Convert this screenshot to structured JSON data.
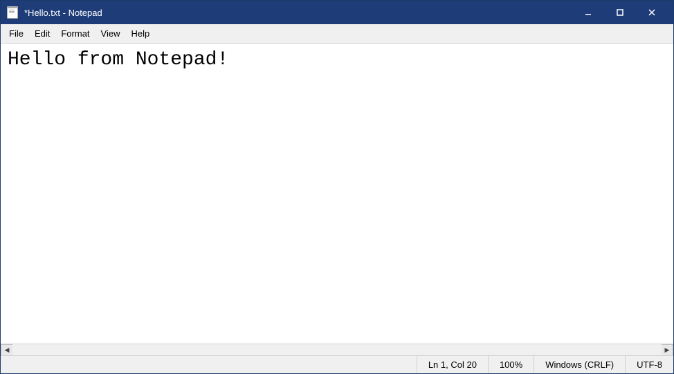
{
  "window": {
    "title": "*Hello.txt - Notepad",
    "icon": "notepad-icon"
  },
  "title_bar": {
    "minimize_label": "minimize",
    "maximize_label": "maximize",
    "close_label": "close"
  },
  "menu_bar": {
    "items": [
      {
        "id": "file",
        "label": "File"
      },
      {
        "id": "edit",
        "label": "Edit"
      },
      {
        "id": "format",
        "label": "Format"
      },
      {
        "id": "view",
        "label": "View"
      },
      {
        "id": "help",
        "label": "Help"
      }
    ]
  },
  "editor": {
    "content": "Hello from Notepad!"
  },
  "status_bar": {
    "cursor_position": "Ln 1, Col 20",
    "zoom": "100%",
    "line_ending": "Windows (CRLF)",
    "encoding": "UTF-8"
  }
}
